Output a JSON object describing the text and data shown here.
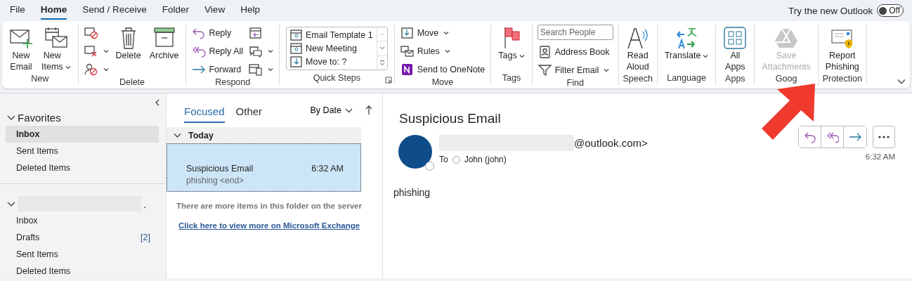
{
  "menu_tabs": [
    {
      "label": "File",
      "selected": false
    },
    {
      "label": "Home",
      "selected": true
    },
    {
      "label": "Send / Receive",
      "selected": false
    },
    {
      "label": "Folder",
      "selected": false
    },
    {
      "label": "View",
      "selected": false
    },
    {
      "label": "Help",
      "selected": false
    }
  ],
  "new_outlook": {
    "label": "Try the new Outlook",
    "toggle_text": "Off",
    "on": false
  },
  "ribbon": {
    "groups": [
      {
        "label": "New",
        "launcher": false,
        "items": [
          {
            "kind": "large",
            "label": "New Email",
            "dropdown": false,
            "disabled": false
          },
          {
            "kind": "large",
            "label": "New Items",
            "dropdown": true,
            "disabled": false
          }
        ]
      },
      {
        "label": "Delete",
        "launcher": false,
        "items": [
          {
            "kind": "icon",
            "dropdown": false,
            "disabled": false
          },
          {
            "kind": "icon",
            "dropdown": true,
            "disabled": false
          },
          {
            "kind": "icon",
            "dropdown": true,
            "disabled": false
          },
          {
            "kind": "large",
            "label": "Delete",
            "dropdown": false,
            "disabled": false
          },
          {
            "kind": "large",
            "label": "Archive",
            "dropdown": false,
            "disabled": false
          }
        ]
      },
      {
        "label": "Respond",
        "launcher": false,
        "items": [
          {
            "kind": "small",
            "label": "Reply",
            "dropdown": false,
            "disabled": false
          },
          {
            "kind": "small",
            "label": "Reply All",
            "dropdown": false,
            "disabled": false
          },
          {
            "kind": "small",
            "label": "Forward",
            "dropdown": false,
            "disabled": false
          },
          {
            "kind": "icon",
            "dropdown": false,
            "disabled": false
          },
          {
            "kind": "icon",
            "dropdown": true,
            "disabled": false
          },
          {
            "kind": "icon",
            "dropdown": true,
            "disabled": false
          }
        ]
      },
      {
        "label": "Quick Steps",
        "launcher": true,
        "items": [
          {
            "kind": "gallery",
            "entries": [
              "Email Template 1",
              "New Meeting",
              "Move to: ?"
            ]
          }
        ]
      },
      {
        "label": "Move",
        "launcher": false,
        "items": [
          {
            "kind": "small",
            "label": "Move",
            "dropdown": true,
            "disabled": false
          },
          {
            "kind": "small",
            "label": "Rules",
            "dropdown": true,
            "disabled": false
          },
          {
            "kind": "small",
            "label": "Send to OneNote",
            "dropdown": false,
            "disabled": false
          }
        ]
      },
      {
        "label": "Tags",
        "launcher": false,
        "items": [
          {
            "kind": "large",
            "label": "Tags",
            "dropdown": true,
            "disabled": false
          }
        ]
      },
      {
        "label": "Find",
        "launcher": false,
        "items": [
          {
            "kind": "search",
            "placeholder": "Search People"
          },
          {
            "kind": "small",
            "label": "Address Book",
            "dropdown": false,
            "disabled": false
          },
          {
            "kind": "small",
            "label": "Filter Email",
            "dropdown": true,
            "disabled": false
          }
        ]
      },
      {
        "label": "Speech",
        "launcher": false,
        "items": [
          {
            "kind": "large",
            "label": "Read Aloud",
            "dropdown": false,
            "disabled": false
          }
        ]
      },
      {
        "label": "Language",
        "launcher": false,
        "items": [
          {
            "kind": "large",
            "label": "Translate",
            "dropdown": true,
            "disabled": false
          }
        ]
      },
      {
        "label": "Apps",
        "launcher": false,
        "items": [
          {
            "kind": "large",
            "label": "All Apps",
            "dropdown": false,
            "disabled": false
          }
        ]
      },
      {
        "label": "Goog",
        "launcher": false,
        "items": [
          {
            "kind": "large",
            "label": "Save Attachments",
            "dropdown": false,
            "disabled": true
          }
        ]
      },
      {
        "label": "Protection",
        "launcher": false,
        "items": [
          {
            "kind": "large",
            "label": "Report Phishing",
            "dropdown": false,
            "disabled": false
          }
        ]
      }
    ]
  },
  "folder_pane": {
    "sections": [
      {
        "label": "Favorites",
        "redacted": false,
        "expanded": true,
        "items": [
          {
            "label": "Inbox",
            "selected": true
          },
          {
            "label": "Sent Items",
            "selected": false
          },
          {
            "label": "Deleted Items",
            "selected": false
          }
        ]
      },
      {
        "label": ".",
        "redacted": true,
        "expanded": true,
        "items": [
          {
            "label": "Inbox",
            "selected": false
          },
          {
            "label": "Drafts",
            "count": "[2]",
            "selected": false
          },
          {
            "label": "Sent Items",
            "selected": false
          },
          {
            "label": "Deleted Items",
            "selected": false
          }
        ]
      }
    ]
  },
  "message_list": {
    "tabs": [
      {
        "label": "Focused",
        "selected": true
      },
      {
        "label": "Other",
        "selected": false
      }
    ],
    "sort": "By Date",
    "groups": [
      {
        "label": "Today",
        "expanded": true,
        "messages": [
          {
            "subject": "Suspicious Email",
            "preview": "phishing <end>",
            "time": "6:32 AM",
            "selected": true
          }
        ]
      }
    ],
    "notice": "There are more items in this folder on the server",
    "link": "Click here to view more on Microsoft Exchange"
  },
  "reading_pane": {
    "subject": "Suspicious Email",
    "sender_redacted": true,
    "sender": "@outlook.com>",
    "to_label": "To",
    "recipient": "John (john)",
    "time": "6:32 AM",
    "body": "phishing"
  }
}
